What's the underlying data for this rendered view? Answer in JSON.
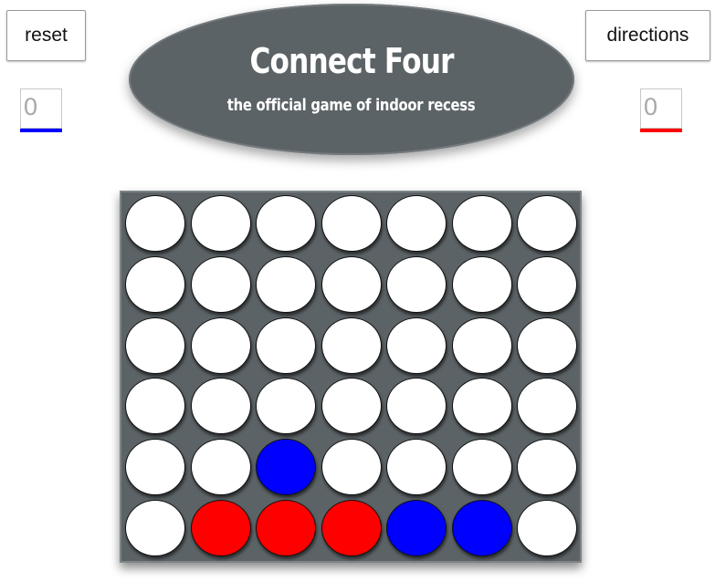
{
  "controls": {
    "reset_label": "reset",
    "directions_label": "directions"
  },
  "banner": {
    "title": "Connect Four",
    "subtitle": "the official game of indoor recess"
  },
  "scores": {
    "blue": {
      "value": "0",
      "color": "#0000ff"
    },
    "red": {
      "value": "0",
      "color": "#ff0000"
    }
  },
  "colors": {
    "empty": "#ffffff",
    "blue": "#0000ff",
    "red": "#ff0000",
    "board": "#5c6366"
  },
  "board": {
    "columns": 7,
    "rows": 6,
    "cells": [
      [
        "empty",
        "empty",
        "empty",
        "empty",
        "empty",
        "empty",
        "empty"
      ],
      [
        "empty",
        "empty",
        "empty",
        "empty",
        "empty",
        "empty",
        "empty"
      ],
      [
        "empty",
        "empty",
        "empty",
        "empty",
        "empty",
        "empty",
        "empty"
      ],
      [
        "empty",
        "empty",
        "empty",
        "empty",
        "empty",
        "empty",
        "empty"
      ],
      [
        "empty",
        "empty",
        "blue",
        "empty",
        "empty",
        "empty",
        "empty"
      ],
      [
        "empty",
        "red",
        "red",
        "red",
        "blue",
        "blue",
        "empty"
      ]
    ]
  }
}
